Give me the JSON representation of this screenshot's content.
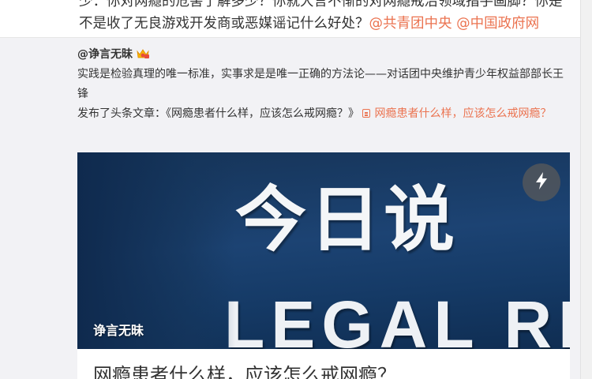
{
  "post": {
    "text_line1": "少：你对网瘾的危害了解多少？你就大言不惭的对网瘾戒治领域指手画脚？你是",
    "text_line2_prefix": "不是收了无良游戏开发商或恶媒谣记什么好处？",
    "mentions": [
      "@共青团中央",
      "@中国政府网"
    ]
  },
  "retweet": {
    "author": "@诤言无昧",
    "badge_icon": "vip-badge-icon",
    "text": "实践是检验真理的唯一标准，实事求是是唯一正确的方法论——对话团中央维护青少年权益部部长王锋",
    "published_prefix": "发布了头条文章：《网瘾患者什么样，应该怎么戒网瘾？》",
    "article_link": "网瘾患者什么样，应该怎么戒网瘾？",
    "card": {
      "image_text_cn": "今日说",
      "image_text_en": "LEGAL REP",
      "image_caption": "诤言无昧",
      "title": "网瘾患者什么样，应该怎么戒网瘾？",
      "action_icon": "lightning-icon"
    }
  },
  "colors": {
    "link": "#eb7350",
    "background": "#f2f2f5",
    "text": "#333333"
  }
}
